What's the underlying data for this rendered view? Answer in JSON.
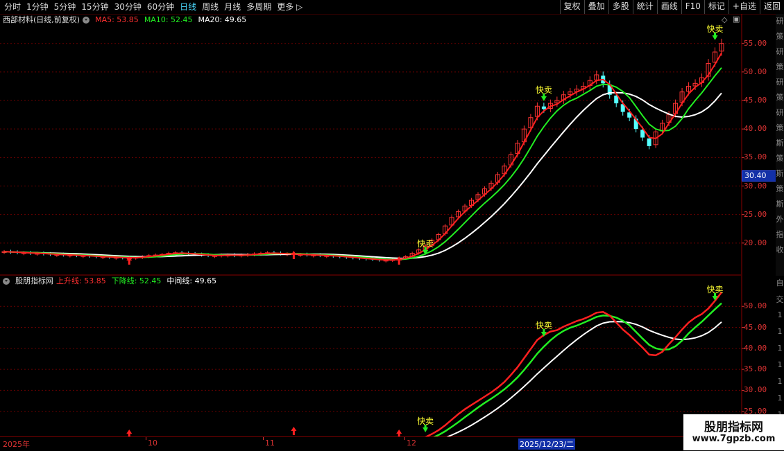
{
  "toolbar": {
    "periods": [
      "分时",
      "1分钟",
      "5分钟",
      "15分钟",
      "30分钟",
      "60分钟",
      "日线",
      "周线",
      "月线",
      "多周期",
      "更多"
    ],
    "active_period": "日线",
    "more_arrow": "▷",
    "tools": [
      "复权",
      "叠加",
      "多股",
      "统计",
      "画线",
      "F10",
      "标记",
      "+自选",
      "返回"
    ]
  },
  "main_legend": {
    "title": "西部材料(日线,前复权)",
    "ma5_label": "MA5: 53.85",
    "ma10_label": "MA10: 52.45",
    "ma20_label": "MA20: 49.65"
  },
  "indicator_legend": {
    "title": "股朋指标网",
    "up_label": "上升线: 53.85",
    "down_label": "下降线: 52.45",
    "mid_label": "中间线: 49.65"
  },
  "price_axis": [
    "55.00",
    "50.00",
    "45.00",
    "40.00",
    "35.00",
    "30.00",
    "25.00",
    "20.00"
  ],
  "current_price": "30.40",
  "indicator_axis": [
    "50.00",
    "45.00",
    "40.00",
    "35.00",
    "30.00",
    "25.00"
  ],
  "date_labels": [
    "2025年",
    "10",
    "11",
    "12",
    "2025/12/23/二"
  ],
  "signals": {
    "sell_fast": "快卖"
  },
  "side_strip_main": [
    "研",
    "策",
    "研",
    "策",
    "研",
    "策",
    "研",
    "策",
    "斯",
    "策",
    "斯",
    "策",
    "斯",
    "外",
    "指",
    "收"
  ],
  "side_strip_ind": [
    "自",
    "交",
    "1",
    "1",
    "1",
    "1",
    "1",
    "1",
    "1",
    "1"
  ],
  "watermark": {
    "title": "股朋指标网",
    "url": "www.7gpzb.com"
  },
  "colors": {
    "up": "#ff3333",
    "down": "#54ffff",
    "ma5": "#ff2020",
    "ma10": "#22ee22",
    "ma20": "#ffffff",
    "accent": "#4ad9ff"
  },
  "icons": {
    "gear": "gear-icon",
    "diamond": "diamond-icon",
    "window": "window-icon"
  },
  "chart_data": {
    "type": "candlestick",
    "price_axis_range": [
      15,
      58
    ],
    "closes": [
      18.5,
      18.4,
      18.3,
      18.3,
      18.2,
      18.2,
      18.1,
      18.0,
      18.0,
      17.9,
      17.9,
      17.8,
      17.8,
      17.7,
      17.6,
      17.6,
      17.5,
      17.5,
      17.4,
      17.4,
      17.5,
      17.6,
      17.8,
      17.9,
      18.0,
      18.2,
      18.3,
      18.2,
      18.1,
      18.0,
      17.9,
      17.8,
      17.8,
      17.9,
      17.9,
      17.8,
      17.9,
      18.0,
      18.1,
      18.2,
      18.3,
      18.2,
      18.1,
      18.1,
      18.0,
      18.0,
      17.9,
      17.9,
      17.8,
      17.8,
      17.7,
      17.6,
      17.5,
      17.4,
      17.3,
      17.2,
      17.1,
      17.0,
      17.0,
      17.1,
      17.3,
      17.6,
      18.2,
      18.8,
      19.5,
      20.5,
      21.5,
      23.0,
      24.5,
      25.5,
      26.5,
      27.5,
      28.5,
      29.5,
      30.5,
      32.0,
      33.5,
      35.5,
      37.5,
      40.0,
      42.0,
      44.0,
      43.5,
      44.5,
      45.0,
      46.0,
      46.5,
      47.0,
      47.5,
      48.5,
      49.5,
      48.0,
      46.0,
      44.5,
      43.0,
      42.0,
      40.0,
      38.5,
      37.0,
      39.5,
      41.0,
      42.5,
      44.5,
      46.5,
      47.5,
      48.0,
      49.0,
      51.5,
      53.5,
      55.0
    ],
    "ma5_last": 53.85,
    "ma10_last": 52.45,
    "ma20_last": 49.65,
    "indicator_axis_range": [
      20,
      54
    ]
  }
}
